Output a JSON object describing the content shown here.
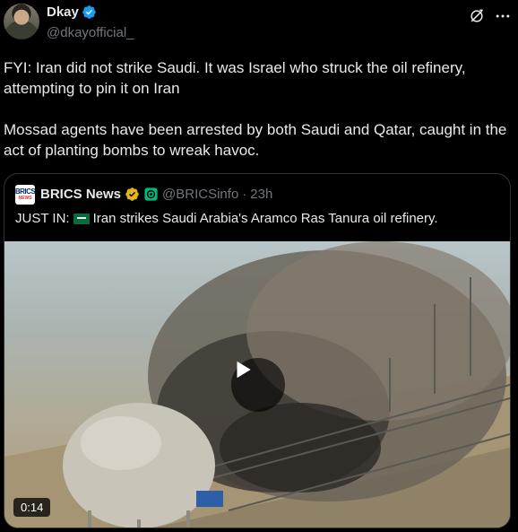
{
  "author": {
    "display_name": "Dkay",
    "handle": "@dkayofficial_",
    "verified": true,
    "verified_color": "#1d9bf0"
  },
  "icons": {
    "grok": "grok-icon",
    "more": "more-icon",
    "verified": "verified-badge-icon",
    "gold_verified": "gold-verified-badge-icon",
    "affiliate": "affiliate-badge-icon",
    "play": "play-icon",
    "flag": "saudi-flag-icon"
  },
  "tweet": {
    "paragraph1": "FYI: Iran did not strike Saudi. It was Israel who struck the oil refinery, attempting to pin it on Iran",
    "paragraph2": "Mossad agents have been arrested by both Saudi and Qatar, caught in the act of planting bombs to wreak havoc."
  },
  "quote": {
    "avatar_text_top": "BRICS",
    "avatar_text_bottom": "NEWS",
    "display_name": "BRICS News",
    "handle": "@BRICSinfo",
    "separator": "·",
    "time": "23h",
    "text_prefix": "JUST IN:",
    "text_body": "Iran strikes Saudi Arabia's Aramco Ras Tanura oil refinery.",
    "video_duration": "0:14",
    "gold_badge_color": "#e2b719",
    "affiliate_badge_color": "#00ba7c"
  },
  "colors": {
    "background": "#000000",
    "text_primary": "#e7e9ea",
    "text_secondary": "#71767b",
    "border": "#2f3336"
  }
}
